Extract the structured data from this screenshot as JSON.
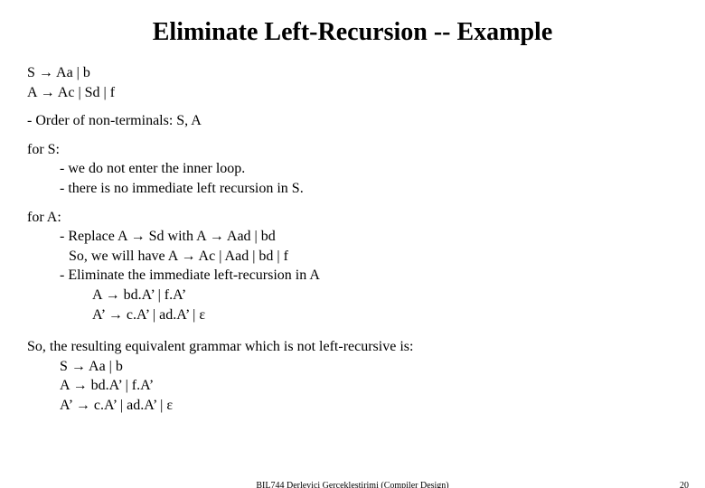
{
  "title": "Eliminate Left-Recursion -- Example",
  "grammar": {
    "s": "S → Aa | b",
    "a": "A → Ac | Sd | f"
  },
  "order": "- Order of non-terminals: S, A",
  "forS": {
    "head": "for S:",
    "l1": "- we do not enter the inner loop.",
    "l2": "- there is no immediate left recursion in S."
  },
  "forA": {
    "head": "for A:",
    "l1": "- Replace A → Sd   with   A → Aad | bd",
    "l2": "So, we will have   A → Ac | Aad | bd | f",
    "l3": "- Eliminate the immediate left-recursion in A",
    "l4": "A → bd.A’ | f.A’",
    "l5": "A’ → c.A’ |  ad.A’ | ε"
  },
  "result": {
    "head": "So, the resulting equivalent grammar which is not left-recursive is:",
    "s": "S → Aa | b",
    "a": "A → bd.A’ | f.A’",
    "ap": "A’ → c.A’ |  ad.A’ | ε"
  },
  "footer": {
    "center": "BIL744  Derleyici Gerçekleştirimi  (Compiler Design)",
    "page": "20"
  }
}
